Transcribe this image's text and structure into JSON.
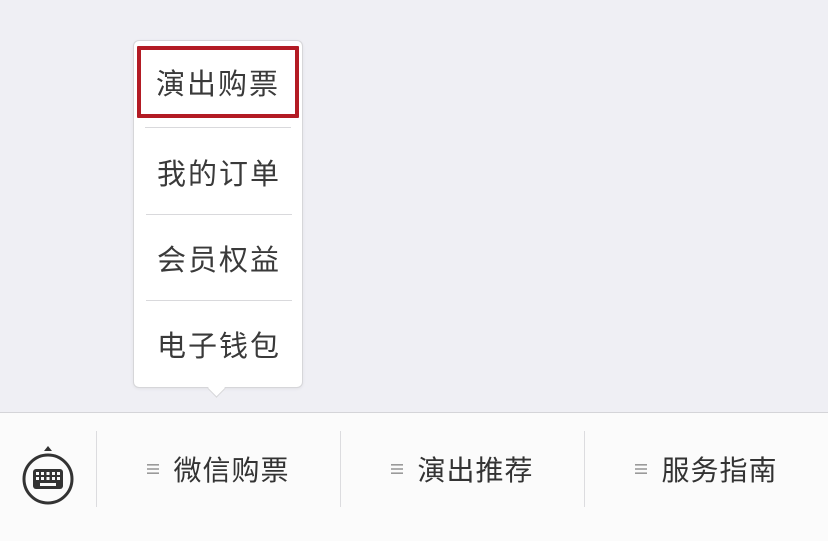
{
  "popup_menu": {
    "items": [
      {
        "label": "演出购票",
        "selected": true
      },
      {
        "label": "我的订单",
        "selected": false
      },
      {
        "label": "会员权益",
        "selected": false
      },
      {
        "label": "电子钱包",
        "selected": false
      }
    ]
  },
  "bottom_menu": {
    "keyboard_icon": "keyboard-toggle-icon",
    "items": [
      {
        "label": "微信购票",
        "icon": "menu-list-icon"
      },
      {
        "label": "演出推荐",
        "icon": "menu-list-icon"
      },
      {
        "label": "服务指南",
        "icon": "menu-list-icon"
      }
    ]
  },
  "colors": {
    "background": "#efeff4",
    "highlight_border": "#b31b24",
    "bar_background": "#fbfbfb"
  }
}
